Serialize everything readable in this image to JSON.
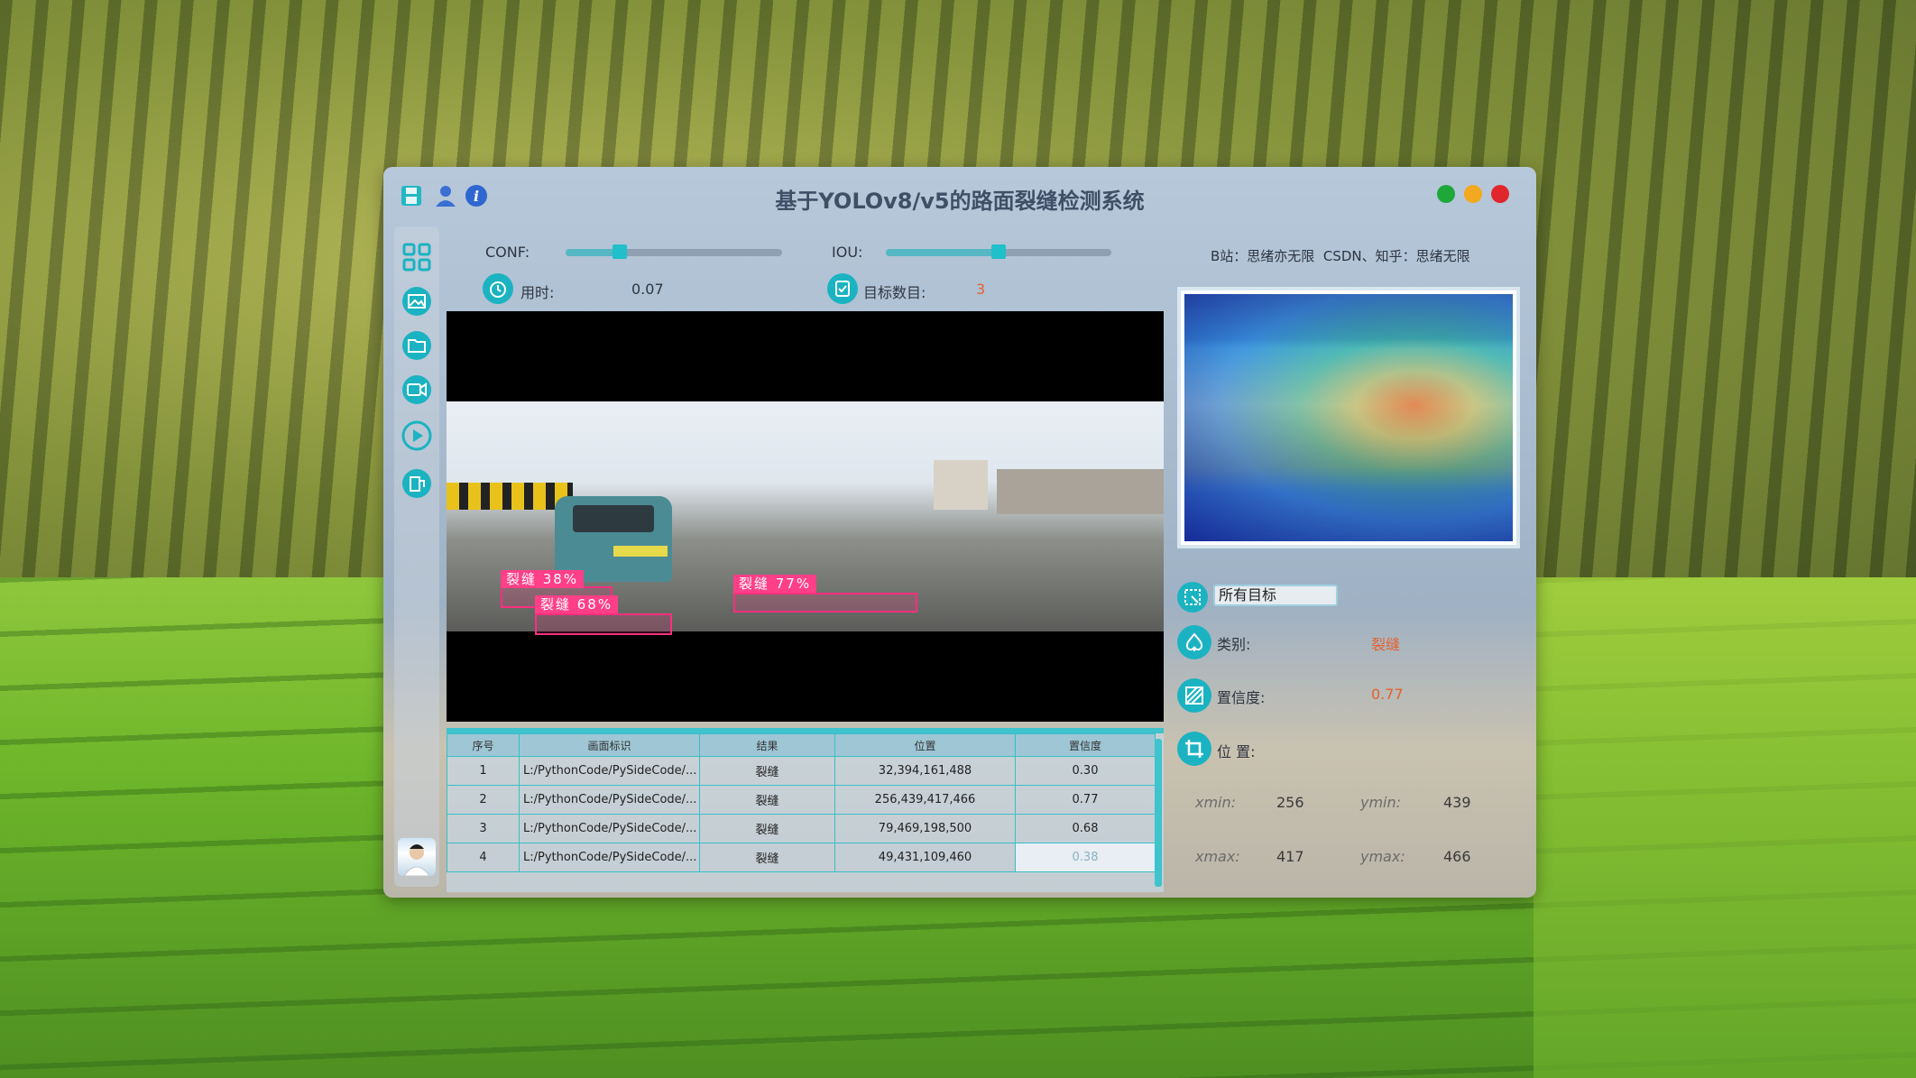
{
  "window": {
    "title": "基于YOLOv8/v5的路面裂缝检测系统",
    "controls": {
      "green": "#1fa83a",
      "yellow": "#f2a91f",
      "red": "#e0262b"
    }
  },
  "params": {
    "conf_label": "CONF:",
    "conf_value": 0.25,
    "iou_label": "IOU:",
    "iou_value": 0.5,
    "time_label": "用时:",
    "time_value": "0.07",
    "count_label": "目标数目:",
    "count_value": "3"
  },
  "credits": "B站：思绪亦无限  CSDN、知乎：思绪无限",
  "detections_overlay": [
    {
      "label": "裂缝 38%"
    },
    {
      "label": "裂缝 68%"
    },
    {
      "label": "裂缝 77%"
    }
  ],
  "table": {
    "headers": [
      "序号",
      "画面标识",
      "结果",
      "位置",
      "置信度"
    ],
    "rows": [
      [
        "1",
        "L:/PythonCode/PySideCode/...",
        "裂缝",
        "32,394,161,488",
        "0.30"
      ],
      [
        "2",
        "L:/PythonCode/PySideCode/...",
        "裂缝",
        "256,439,417,466",
        "0.77"
      ],
      [
        "3",
        "L:/PythonCode/PySideCode/...",
        "裂缝",
        "79,469,198,500",
        "0.68"
      ],
      [
        "4",
        "L:/PythonCode/PySideCode/...",
        "裂缝",
        "49,431,109,460",
        "0.38"
      ]
    ]
  },
  "target_panel": {
    "target_select": "所有目标",
    "class_label": "类别:",
    "class_value": "裂缝",
    "conf_label": "置信度:",
    "conf_value": "0.77",
    "pos_label": "位 置:",
    "xmin_label": "xmin:",
    "xmin_value": "256",
    "ymin_label": "ymin:",
    "ymin_value": "439",
    "xmax_label": "xmax:",
    "xmax_value": "417",
    "ymax_label": "ymax:",
    "ymax_value": "466"
  },
  "colors": {
    "accent": "#1bb3c1",
    "box": "#ff2f7e",
    "highlight_text": "#e5612d"
  }
}
